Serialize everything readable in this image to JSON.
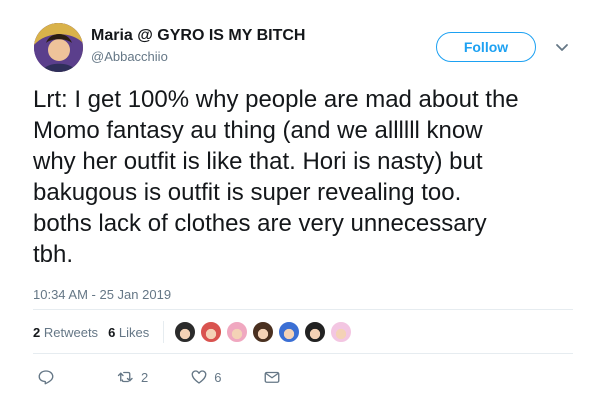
{
  "user": {
    "display_name": "Maria @ GYRO IS MY BITCH",
    "handle": "@Abbacchiio"
  },
  "header": {
    "follow_label": "Follow"
  },
  "tweet": {
    "text": "Lrt: I get 100% why people are mad about the\nMomo fantasy au thing (and we allllll know\nwhy her outfit is like that. Hori is nasty) but\nbakugous is outfit is super revealing too.\nboths lack of clothes are very unnecessary\ntbh.",
    "timestamp": "10:34 AM - 25 Jan 2019"
  },
  "stats": {
    "retweets_count": "2",
    "retweets_label": "Retweets",
    "likes_count": "6",
    "likes_label": "Likes"
  },
  "liker_avatars": [
    {
      "name": "liker-avatar-1",
      "color": "#2b2b2b"
    },
    {
      "name": "liker-avatar-2",
      "color": "#d9534f"
    },
    {
      "name": "liker-avatar-3",
      "color": "#f0a8c0"
    },
    {
      "name": "liker-avatar-4",
      "color": "#4a3020"
    },
    {
      "name": "liker-avatar-5",
      "color": "#3b6fd4"
    },
    {
      "name": "liker-avatar-6",
      "color": "#222222"
    },
    {
      "name": "liker-avatar-7",
      "color": "#f3c6e2"
    }
  ],
  "actions": {
    "reply_icon": "reply-icon",
    "retweet_icon": "retweet-icon",
    "retweet_count": "2",
    "like_icon": "heart-icon",
    "like_count": "6",
    "dm_icon": "envelope-icon"
  },
  "colors": {
    "accent": "#1da1f2",
    "secondary_text": "#657786",
    "primary_text": "#14171a"
  }
}
